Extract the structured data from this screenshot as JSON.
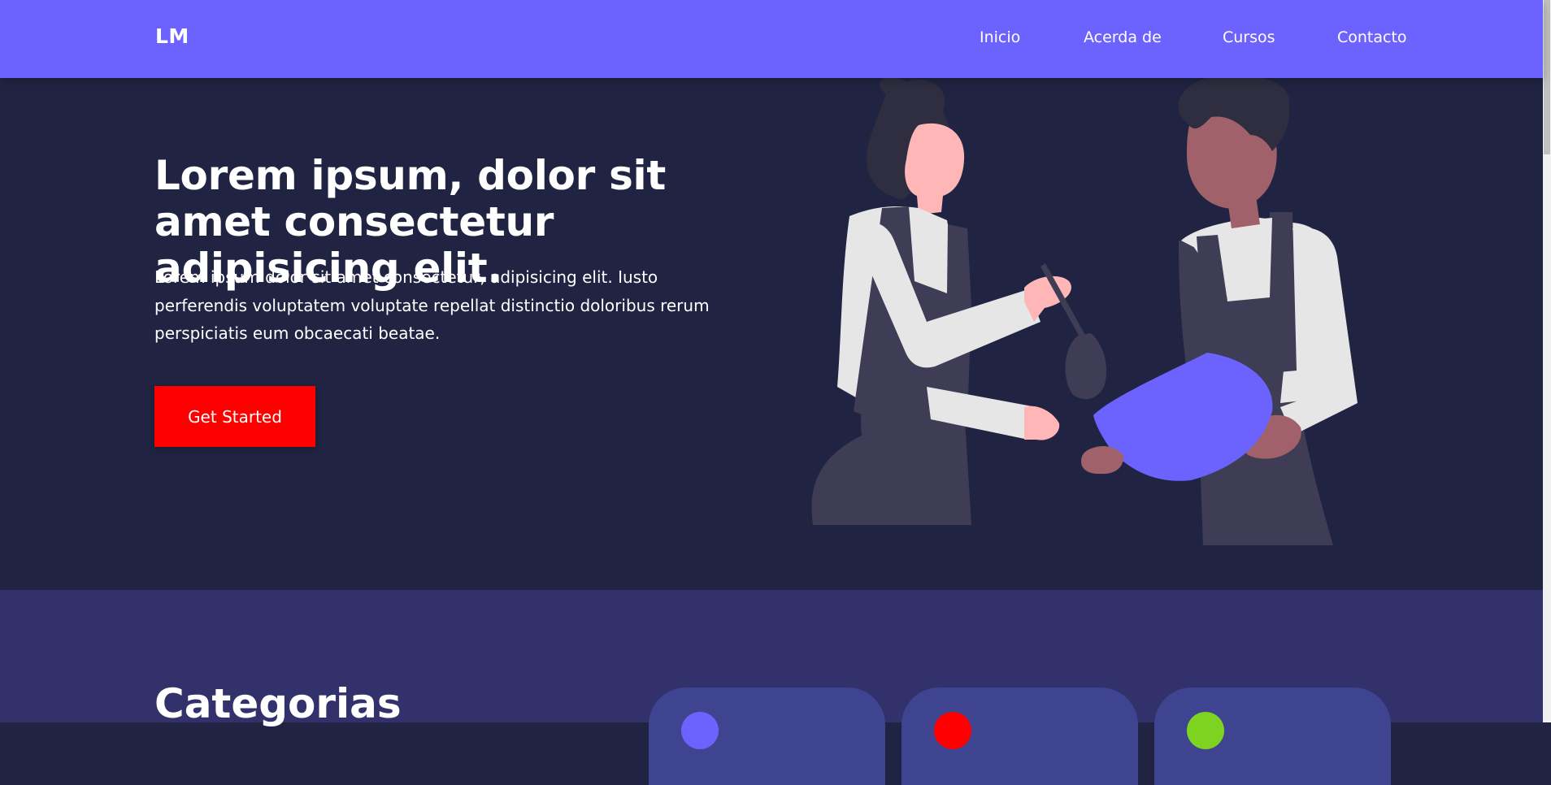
{
  "nav": {
    "logo": "LM",
    "links": [
      "Inicio",
      "Acerda de",
      "Cursos",
      "Contacto"
    ]
  },
  "hero": {
    "title": "Lorem ipsum, dolor sit amet consectetur adipisicing elit.",
    "text": "Lorem ipsum dolor sit amet consectetur, adipisicing elit. Iusto perferendis voluptatem voluptate repellat distinctio doloribus rerum perspiciatis eum obcaecati beatae.",
    "cta_label": "Get Started"
  },
  "categories": {
    "title": "Categorias",
    "cards": [
      {
        "icon_color": "#6c63ff"
      },
      {
        "icon_color": "#ff0000"
      },
      {
        "icon_color": "#7ed321"
      }
    ]
  },
  "colors": {
    "navbar": "#6c63ff",
    "hero_bg": "#202442",
    "categories_bg": "#32316b",
    "card_bg": "#3e448f",
    "cta": "#ff0000"
  }
}
